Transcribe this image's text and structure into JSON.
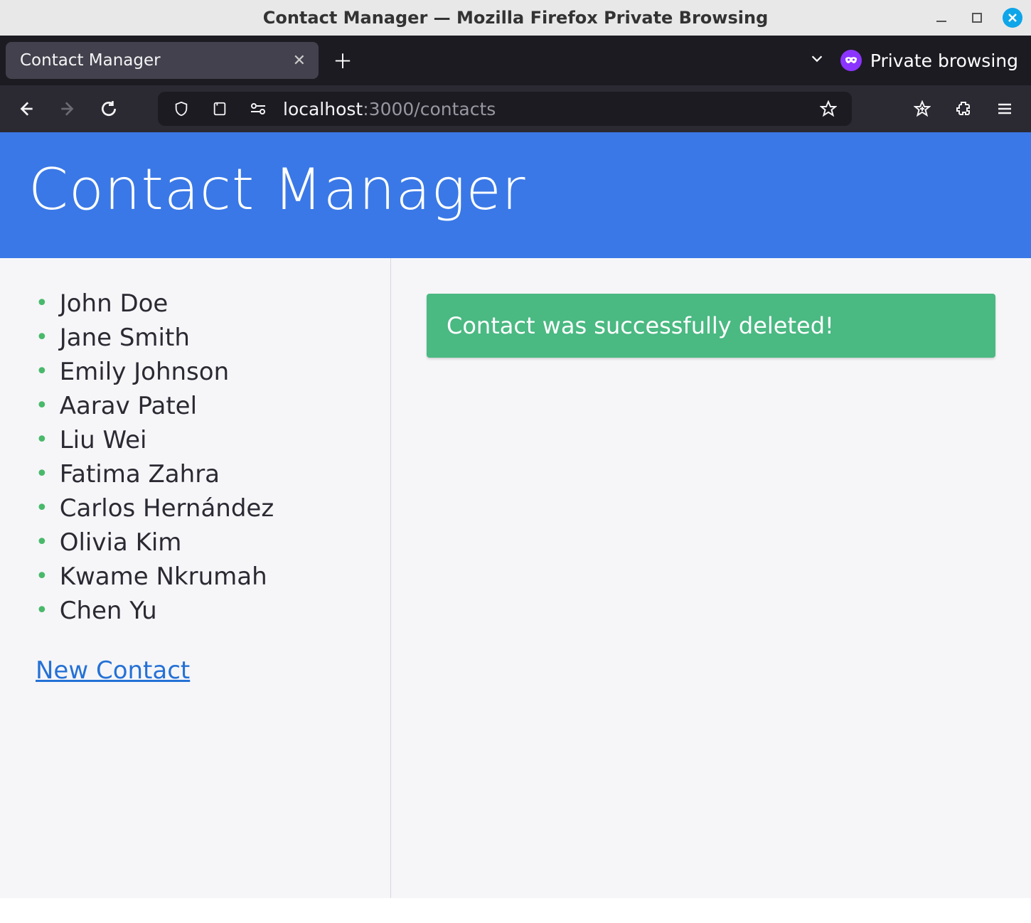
{
  "window": {
    "title": "Contact Manager — Mozilla Firefox Private Browsing"
  },
  "browser": {
    "tab_title": "Contact Manager",
    "private_label": "Private browsing",
    "url_host": "localhost",
    "url_path": ":3000/contacts"
  },
  "page": {
    "heading": "Contact Manager",
    "flash_message": "Contact was successfully deleted!",
    "new_contact_label": "New Contact",
    "contacts": [
      "John Doe",
      "Jane Smith",
      "Emily Johnson",
      "Aarav Patel",
      "Liu Wei",
      "Fatima Zahra",
      "Carlos Hernández",
      "Olivia Kim",
      "Kwame Nkrumah",
      "Chen Yu"
    ]
  }
}
